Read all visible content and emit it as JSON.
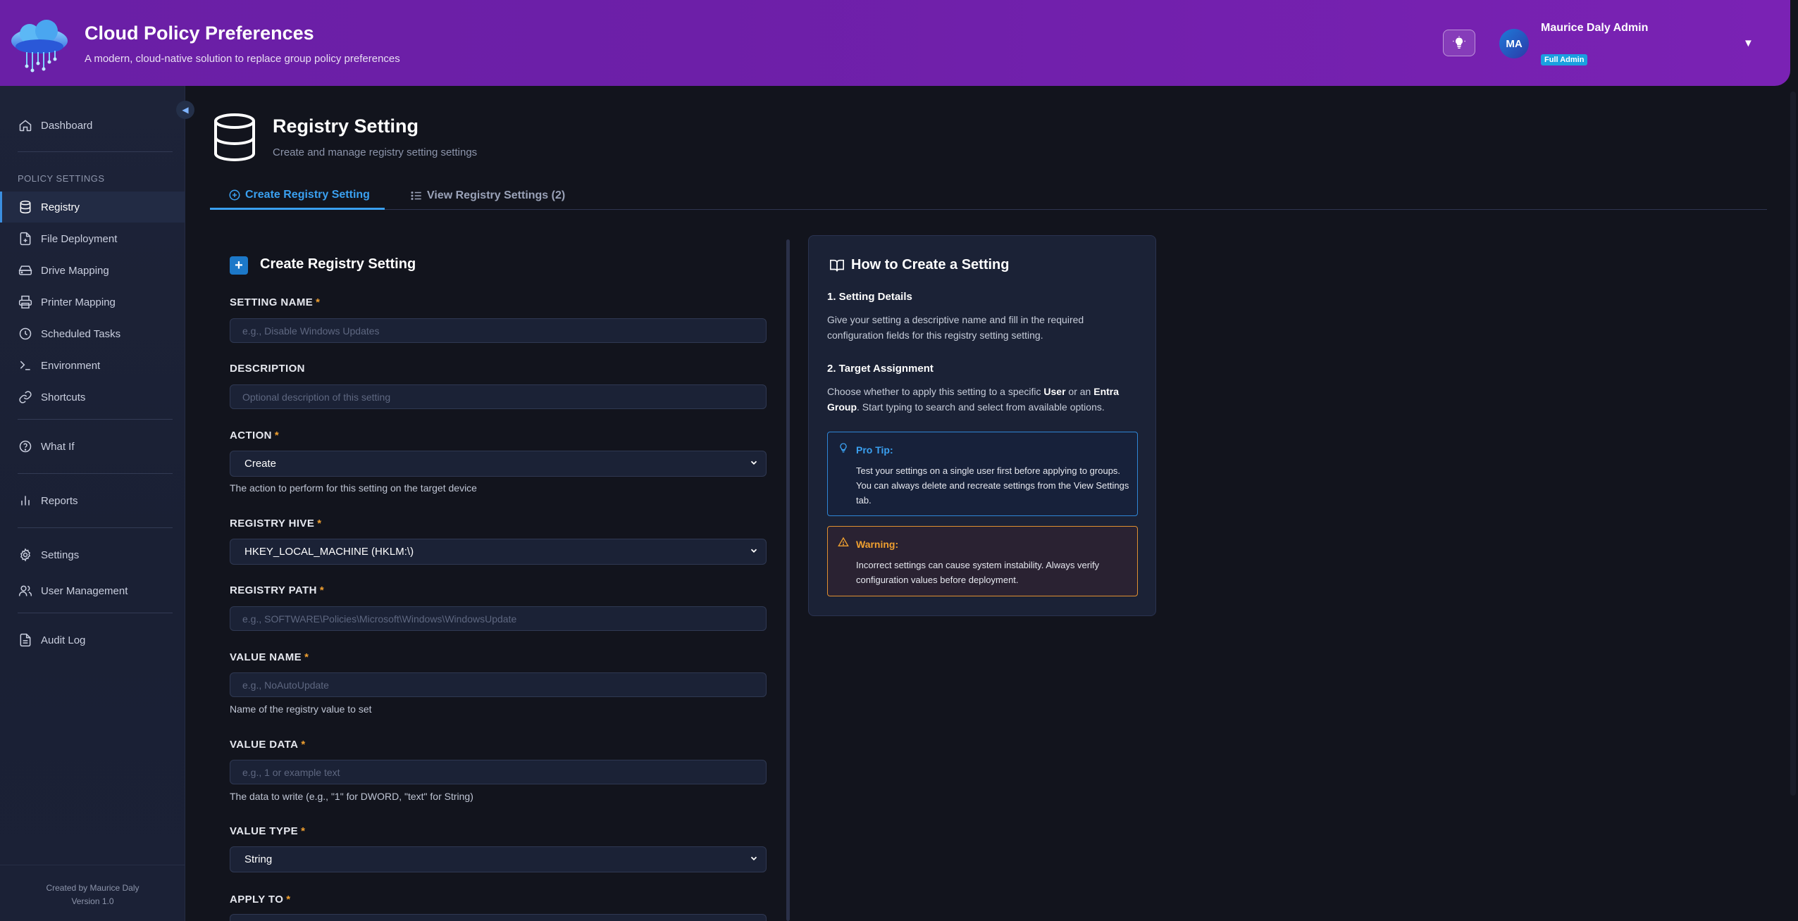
{
  "header": {
    "title": "Cloud Policy Preferences",
    "subtitle": "A modern, cloud-native solution to replace group policy preferences",
    "theme_icon": "lightbulb-icon",
    "user": {
      "initials": "MA",
      "name": "Maurice Daly Admin",
      "role": "Full Admin"
    }
  },
  "sidebar": {
    "items_top": [
      {
        "label": "Dashboard",
        "icon": "home-icon"
      }
    ],
    "section_label": "POLICY SETTINGS",
    "policy_items": [
      {
        "label": "Registry",
        "icon": "database-icon",
        "active": true
      },
      {
        "label": "File Deployment",
        "icon": "file-icon"
      },
      {
        "label": "Drive Mapping",
        "icon": "hard-drive-icon"
      },
      {
        "label": "Printer Mapping",
        "icon": "printer-icon"
      },
      {
        "label": "Scheduled Tasks",
        "icon": "clock-icon"
      },
      {
        "label": "Environment",
        "icon": "terminal-icon"
      },
      {
        "label": "Shortcuts",
        "icon": "link-icon"
      }
    ],
    "what_if": "What If",
    "reports": "Reports",
    "settings": "Settings",
    "user_management": "User Management",
    "audit_log": "Audit Log",
    "footer_created": "Created by Maurice Daly",
    "footer_version": "Version 1.0"
  },
  "page": {
    "title": "Registry Setting",
    "subtitle": "Create and manage registry setting settings"
  },
  "tabs": {
    "create": "Create Registry Setting",
    "view": "View Registry Settings (2)"
  },
  "form": {
    "heading_icon": "+",
    "heading": "Create Registry Setting",
    "setting_name": {
      "label": "SETTING NAME",
      "placeholder": "e.g., Disable Windows Updates"
    },
    "description": {
      "label": "DESCRIPTION",
      "placeholder": "Optional description of this setting"
    },
    "action": {
      "label": "ACTION",
      "value": "Create",
      "help": "The action to perform for this setting on the target device"
    },
    "registry_hive": {
      "label": "REGISTRY HIVE",
      "value": "HKEY_LOCAL_MACHINE (HKLM:\\)"
    },
    "registry_path": {
      "label": "REGISTRY PATH",
      "placeholder": "e.g., SOFTWARE\\Policies\\Microsoft\\Windows\\WindowsUpdate"
    },
    "value_name": {
      "label": "VALUE NAME",
      "placeholder": "e.g., NoAutoUpdate",
      "help": "Name of the registry value to set"
    },
    "value_data": {
      "label": "VALUE DATA",
      "placeholder": "e.g., 1 or example text",
      "help": "The data to write (e.g., \"1\" for DWORD, \"text\" for String)"
    },
    "value_type": {
      "label": "VALUE TYPE",
      "value": "String"
    },
    "apply_to": {
      "label": "APPLY TO"
    },
    "required_mark": "*"
  },
  "help_panel": {
    "title": "How to Create a Setting",
    "step1_title": "1. Setting Details",
    "step1_text": "Give your setting a descriptive name and fill in the required configuration fields for this registry setting setting.",
    "step2_title": "2. Target Assignment",
    "step2_text_a": "Choose whether to apply this setting to a specific ",
    "step2_user": "User",
    "step2_text_b": " or an ",
    "step2_group": "Entra Group",
    "step2_text_c": ". Start typing to search and select from available options.",
    "tip_title": "Pro Tip:",
    "tip_text": "Test your settings on a single user first before applying to groups. You can always delete and recreate settings from the View Settings tab.",
    "warning_title": "Warning:",
    "warning_text": "Incorrect settings can cause system instability. Always verify configuration values before deployment."
  },
  "colors": {
    "header_gradient_start": "#6a1fa6",
    "accent_blue": "#3aa0f0",
    "required_orange": "#f0a030",
    "tip_border": "#2f86d6",
    "warning_border": "#e09030"
  }
}
